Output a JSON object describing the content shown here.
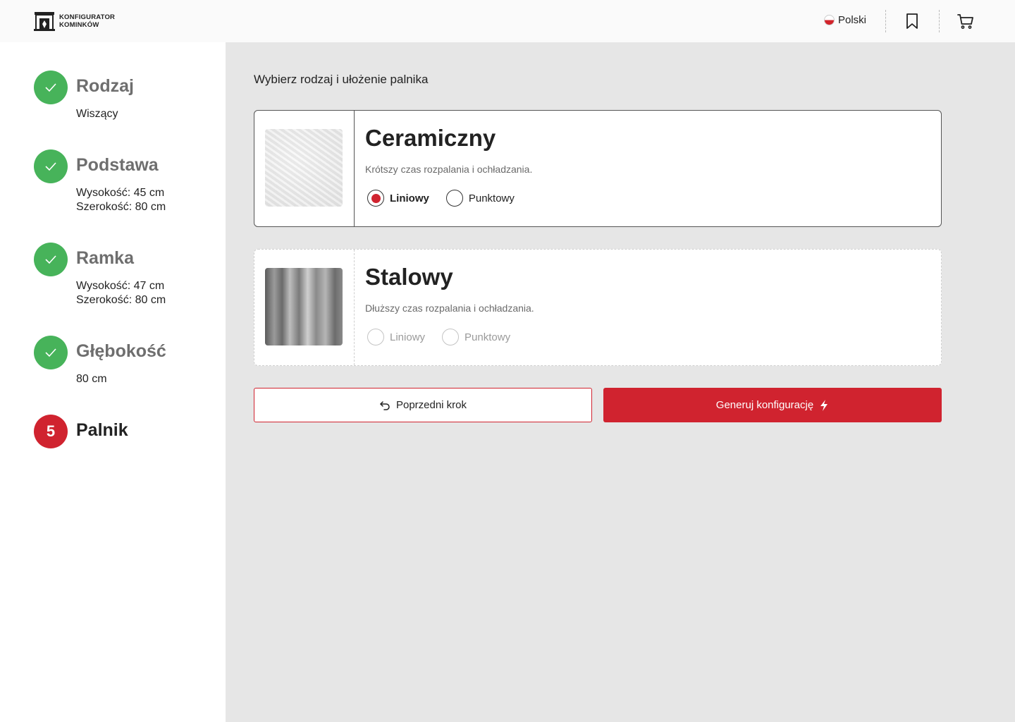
{
  "header": {
    "logo_line1": "KONFIGURATOR",
    "logo_line2": "KOMINKÓW",
    "language": "Polski"
  },
  "sidebar": {
    "steps": [
      {
        "title": "Rodzaj",
        "details": [
          "Wiszący"
        ],
        "status": "done"
      },
      {
        "title": "Podstawa",
        "details": [
          "Wysokość: 45 cm",
          "Szerokość: 80 cm"
        ],
        "status": "done"
      },
      {
        "title": "Ramka",
        "details": [
          "Wysokość: 47 cm",
          "Szerokość: 80 cm"
        ],
        "status": "done"
      },
      {
        "title": "Głębokość",
        "details": [
          "80 cm"
        ],
        "status": "done"
      },
      {
        "title": "Palnik",
        "number": "5",
        "status": "active"
      }
    ]
  },
  "main": {
    "title": "Wybierz rodzaj i ułożenie palnika",
    "cards": [
      {
        "name": "Ceramiczny",
        "description": "Krótszy czas rozpalania i ochładzania.",
        "options": [
          "Liniowy",
          "Punktowy"
        ],
        "selected_option": "Liniowy",
        "state": "selected"
      },
      {
        "name": "Stalowy",
        "description": "Dłuższy czas rozpalania i ochładzania.",
        "options": [
          "Liniowy",
          "Punktowy"
        ],
        "state": "disabled"
      }
    ],
    "prev_button": "Poprzedni krok",
    "generate_button": "Generuj konfigurację"
  },
  "colors": {
    "accent": "#d0232f",
    "success": "#47b35a",
    "main_bg": "#e6e6e6"
  }
}
